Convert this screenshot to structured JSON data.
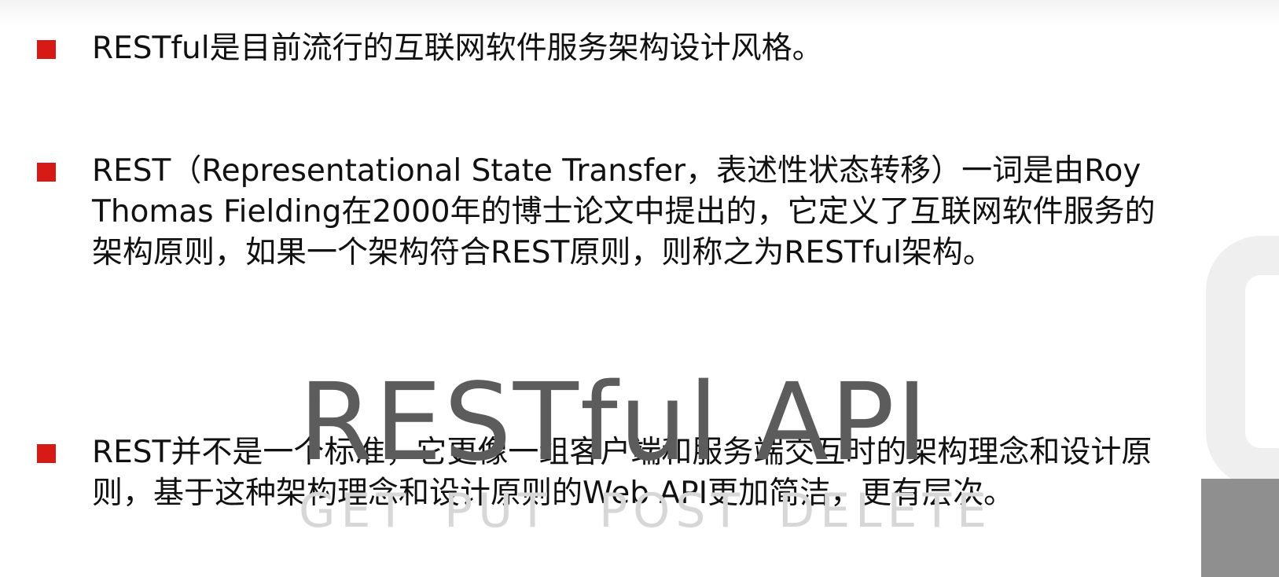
{
  "bullets": [
    {
      "text": "RESTful是目前流行的互联网软件服务架构设计风格。"
    },
    {
      "text": "REST（Representational State Transfer，表述性状态转移）一词是由Roy\nThomas Fielding在2000年的博士论文中提出的，它定义了互联网软件服务的\n架构原则，如果一个架构符合REST原则，则称之为RESTful架构。"
    },
    {
      "text": "REST并不是一个标准，它更像一组客户端和服务端交互时的架构理念和设计原\n则，基于这种架构理念和设计原则的Web API更加简洁，更有层次。"
    }
  ],
  "graphic": {
    "title": "RESTful API",
    "methods": [
      "GET",
      "PUT",
      "POST",
      "DELETE"
    ]
  },
  "colors": {
    "bullet_marker": "#d61a16",
    "graphic_title": "#5c5c5c",
    "methods": "#d7d7d7",
    "corner_block": "#8f8f8f"
  }
}
